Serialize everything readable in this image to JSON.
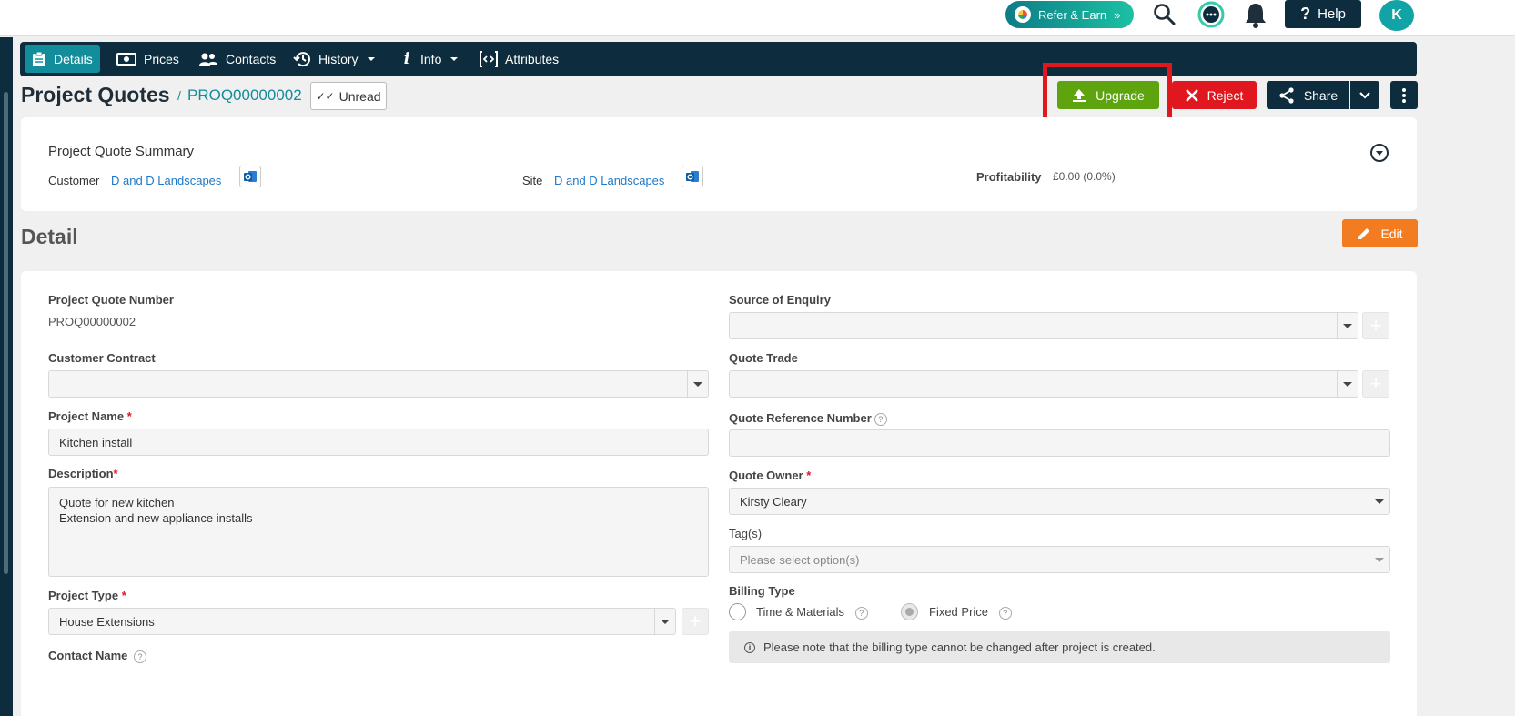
{
  "topbar": {
    "refer_label": "Refer & Earn",
    "help_label": "Help",
    "avatar_initial": "K"
  },
  "nav": {
    "details": "Details",
    "prices": "Prices",
    "contacts": "Contacts",
    "history": "History",
    "info": "Info",
    "attributes": "Attributes"
  },
  "header": {
    "title": "Project Quotes",
    "separator": "/",
    "reference": "PROQ00000002",
    "unread_label": "Unread",
    "upgrade_label": "Upgrade",
    "reject_label": "Reject",
    "share_label": "Share"
  },
  "summary": {
    "title": "Project Quote Summary",
    "customer_label": "Customer",
    "customer_value": "D and D Landscapes",
    "site_label": "Site",
    "site_value": "D and D Landscapes",
    "profitability_label": "Profitability",
    "profitability_value": "£0.00 (0.0%)"
  },
  "detail": {
    "heading": "Detail",
    "edit_label": "Edit",
    "quote_number_label": "Project Quote Number",
    "quote_number_value": "PROQ00000002",
    "customer_contract_label": "Customer Contract",
    "customer_contract_value": "",
    "project_name_label": "Project Name",
    "project_name_value": "Kitchen install",
    "description_label": "Description",
    "description_line1": "Quote for new kitchen",
    "description_line2": "Extension and new appliance installs",
    "project_type_label": "Project Type",
    "project_type_value": "House Extensions",
    "contact_name_label": "Contact Name",
    "source_label": "Source of Enquiry",
    "source_value": "",
    "trade_label": "Quote Trade",
    "trade_value": "",
    "ref_number_label": "Quote Reference Number",
    "ref_number_value": "",
    "owner_label": "Quote Owner",
    "owner_value": "Kirsty Cleary",
    "tags_label": "Tag(s)",
    "tags_placeholder": "Please select option(s)",
    "billing_label": "Billing Type",
    "billing_options": [
      "Time & Materials",
      "Fixed Price"
    ],
    "billing_selected": "Fixed Price",
    "billing_notice": "Please note that the billing type cannot be changed after project is created.",
    "required_mark": "*"
  },
  "colors": {
    "nav_bg": "#0d2d3e",
    "accent_teal": "#138d9b",
    "upgrade_green": "#5ea40e",
    "reject_red": "#e0171f",
    "edit_orange": "#f47c20",
    "highlight_red": "#e0171f"
  }
}
